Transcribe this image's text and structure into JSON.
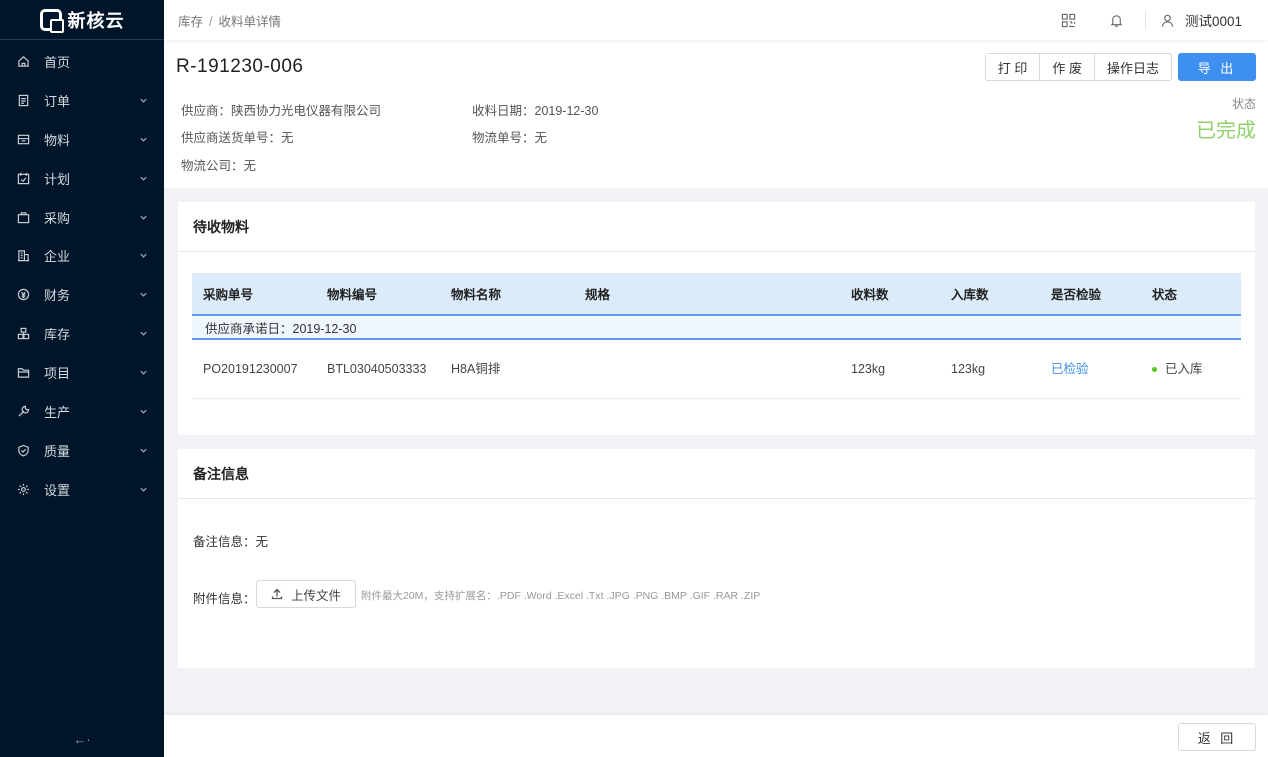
{
  "app": {
    "logo_text": "新核云"
  },
  "sidebar": {
    "items": [
      {
        "label": "首页",
        "icon": "home-icon",
        "has_children": false
      },
      {
        "label": "订单",
        "icon": "order-icon",
        "has_children": true
      },
      {
        "label": "物料",
        "icon": "material-icon",
        "has_children": true
      },
      {
        "label": "计划",
        "icon": "plan-icon",
        "has_children": true
      },
      {
        "label": "采购",
        "icon": "purchase-icon",
        "has_children": true
      },
      {
        "label": "企业",
        "icon": "enterprise-icon",
        "has_children": true
      },
      {
        "label": "财务",
        "icon": "finance-icon",
        "has_children": true
      },
      {
        "label": "库存",
        "icon": "inventory-icon",
        "has_children": true
      },
      {
        "label": "项目",
        "icon": "project-icon",
        "has_children": true
      },
      {
        "label": "生产",
        "icon": "production-icon",
        "has_children": true
      },
      {
        "label": "质量",
        "icon": "quality-icon",
        "has_children": true
      },
      {
        "label": "设置",
        "icon": "settings-icon",
        "has_children": true
      }
    ],
    "collapse_label": "←·"
  },
  "topbar": {
    "breadcrumb": [
      "库存",
      "收料单详情"
    ],
    "breadcrumb_sep": "/",
    "user_name": "测试0001"
  },
  "header": {
    "doc_no": "R-191230-006",
    "actions": [
      "打 印",
      "作 废",
      "操作日志"
    ],
    "export_label": "导 出",
    "fields": {
      "supplier": "供应商：陕西协力光电仪器有限公司",
      "receive_date": "收料日期：2019-12-30",
      "supplier_delivery_no": "供应商送货单号：无",
      "logistics_no": "物流单号：无",
      "logistics_company": "物流公司：无"
    },
    "status_label": "状态",
    "status_value": "已完成"
  },
  "pending": {
    "title": "待收物料",
    "columns": [
      "采购单号",
      "物料编号",
      "物料名称",
      "规格",
      "收料数",
      "入库数",
      "是否检验",
      "状态"
    ],
    "group_label": "供应商承诺日：2019-12-30",
    "rows": [
      {
        "po_no": "PO20191230007",
        "material_no": "BTL03040503333",
        "material_name": "H8A铜排",
        "spec": "",
        "received": "123kg",
        "stocked": "123kg",
        "inspected": "已检验",
        "status": "已入库"
      }
    ]
  },
  "notes": {
    "title": "备注信息",
    "remark": "备注信息：无",
    "attachment_label": "附件信息：",
    "upload_label": "上传文件",
    "upload_hint": "附件最大20M，支持扩展名：.PDF .Word .Excel .Txt .JPG .PNG .BMP .GIF .RAR .ZIP"
  },
  "footer": {
    "back_label": "返 回"
  },
  "colors": {
    "sidebar_bg": "#001529",
    "primary": "#3d8ff0",
    "status_done": "#8fd16a",
    "stocked_dot": "#52c41a"
  }
}
